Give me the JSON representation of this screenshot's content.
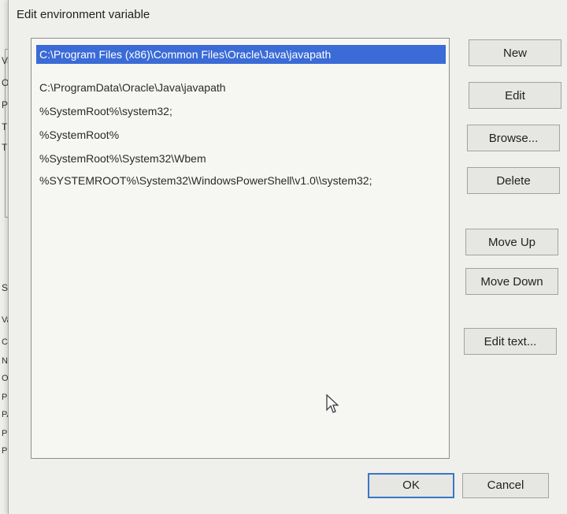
{
  "background_window": {
    "left_fragments": [
      "Va",
      "Oi",
      "Pa",
      "TE",
      "TN"
    ],
    "section_label": "Syst",
    "list_fragments": [
      "Va",
      "Ce",
      "NI",
      "O!",
      "Pa",
      "PA",
      "PF",
      "PF"
    ]
  },
  "dialog": {
    "title": "Edit environment variable",
    "entries": [
      "C:\\Program Files (x86)\\Common Files\\Oracle\\Java\\javapath",
      "C:\\ProgramData\\Oracle\\Java\\javapath",
      "%SystemRoot%\\system32;",
      "%SystemRoot%",
      "%SystemRoot%\\System32\\Wbem",
      "%SYSTEMROOT%\\System32\\WindowsPowerShell\\v1.0\\\\system32;"
    ],
    "selected_index": 0,
    "buttons": {
      "new": "New",
      "edit": "Edit",
      "browse": "Browse...",
      "delete": "Delete",
      "move_up": "Move Up",
      "move_down": "Move Down",
      "edit_text": "Edit text..."
    },
    "footer": {
      "ok": "OK",
      "cancel": "Cancel"
    }
  },
  "colors": {
    "selection": "#3a6bd6",
    "focus_border": "#3a76c8"
  }
}
